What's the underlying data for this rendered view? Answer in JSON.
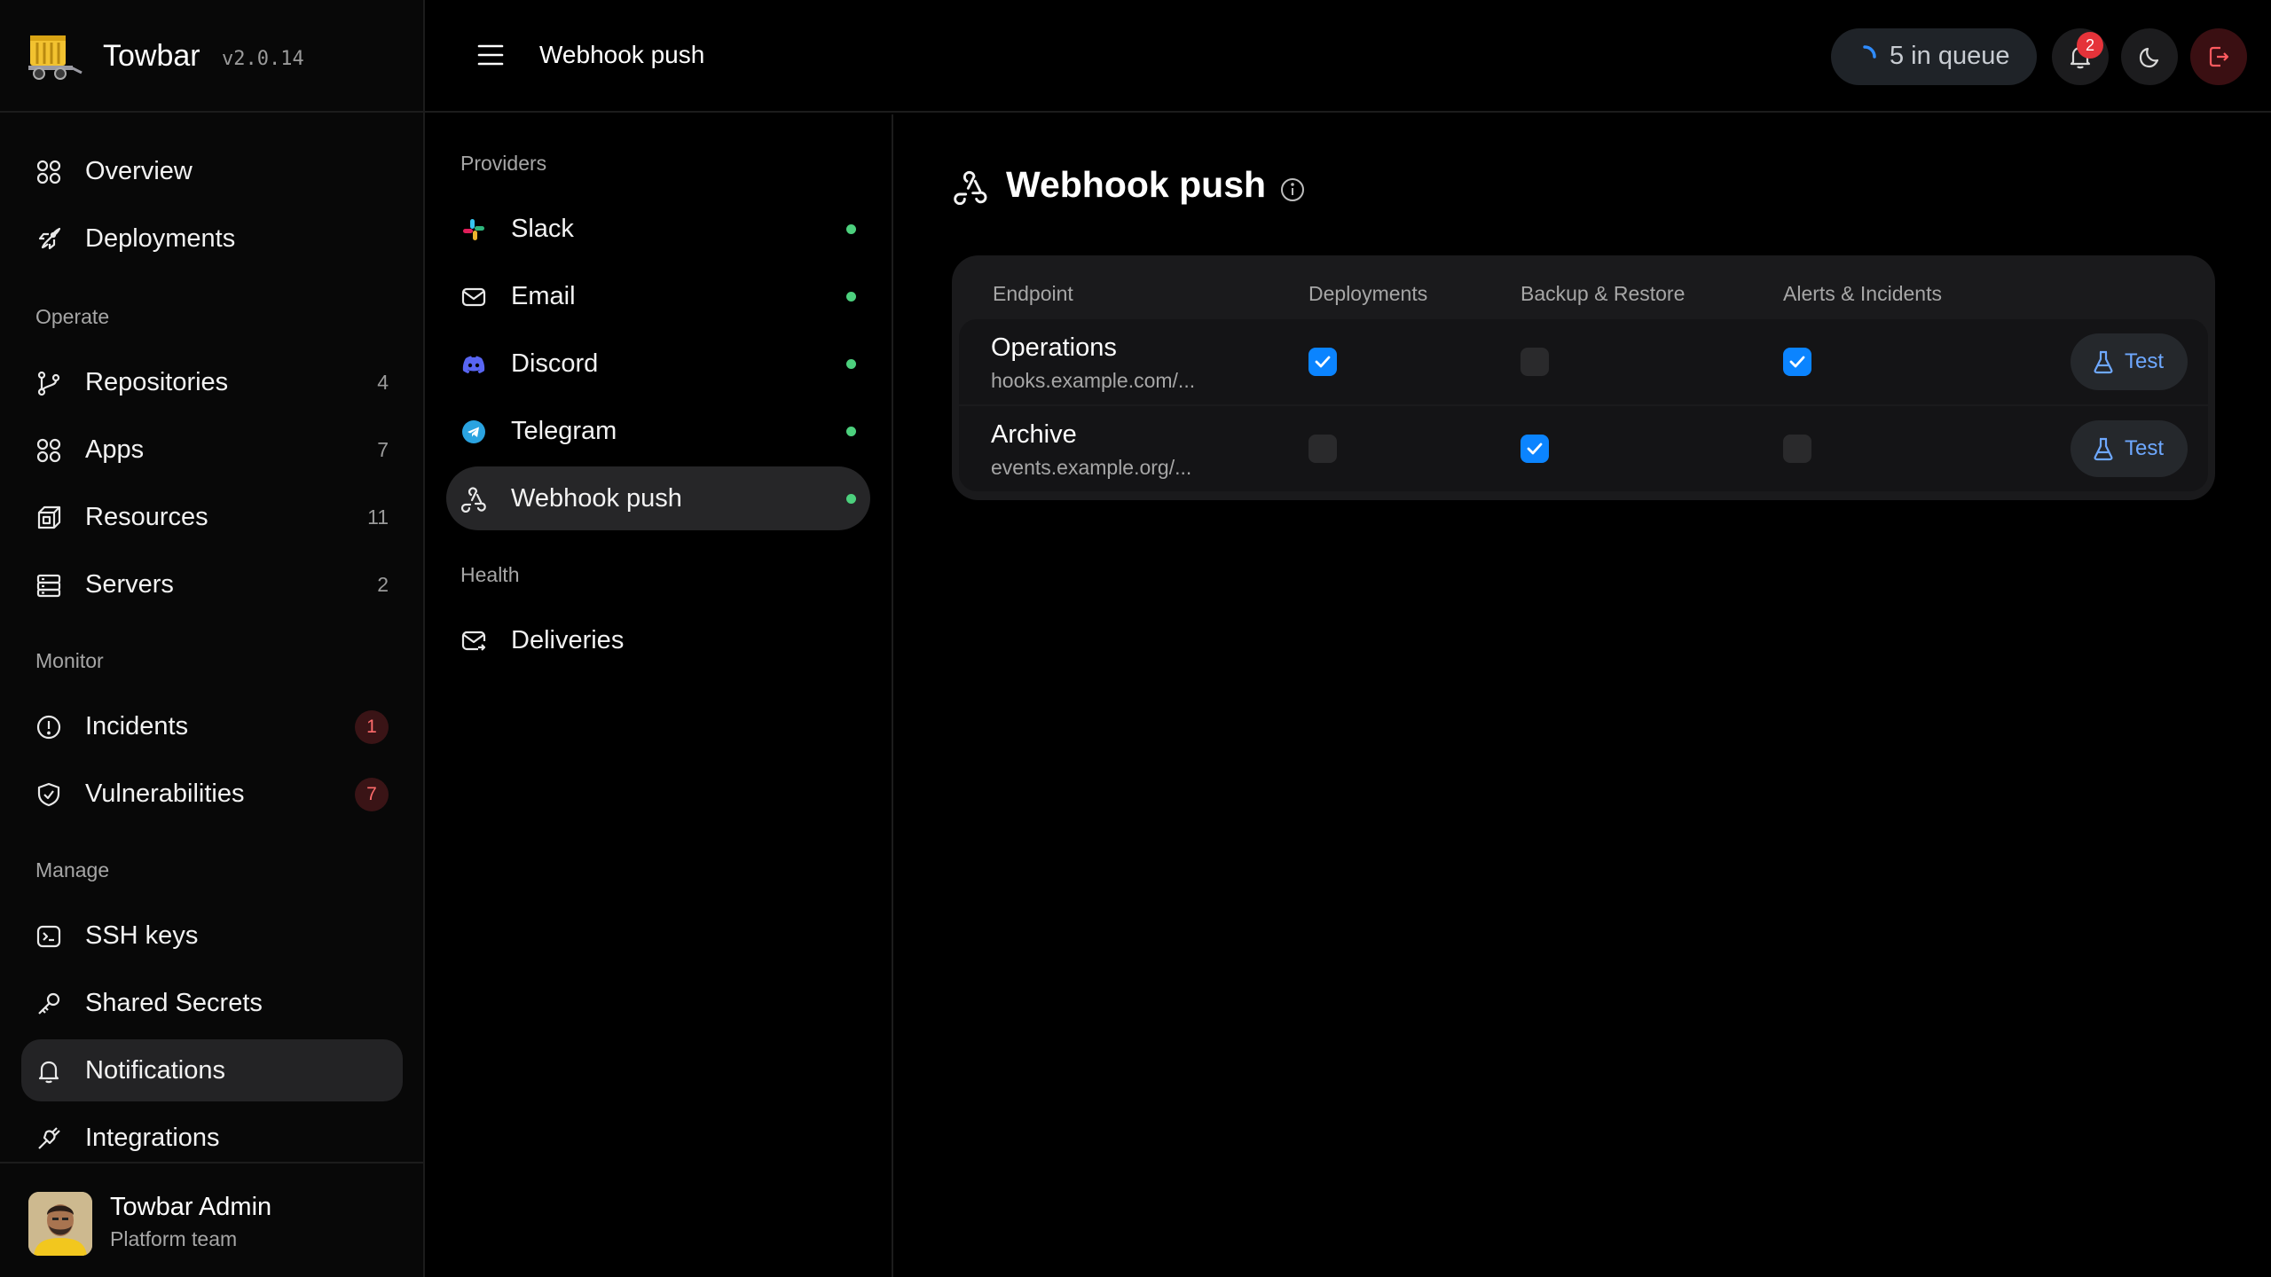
{
  "app": {
    "name": "Towbar",
    "version": "v2.0.14"
  },
  "sidebar": {
    "items_top": [
      {
        "label": "Overview",
        "icon": "grid-icon"
      },
      {
        "label": "Deployments",
        "icon": "rocket-icon"
      }
    ],
    "sections": [
      "Operate",
      "Monitor",
      "Manage"
    ],
    "operate": [
      {
        "label": "Repositories",
        "count": "4",
        "icon": "git-branch-icon"
      },
      {
        "label": "Apps",
        "count": "7",
        "icon": "apps-icon"
      },
      {
        "label": "Resources",
        "count": "11",
        "icon": "cube-icon"
      },
      {
        "label": "Servers",
        "count": "2",
        "icon": "server-icon"
      }
    ],
    "monitor": [
      {
        "label": "Incidents",
        "badge": "1",
        "icon": "alert-circle-icon"
      },
      {
        "label": "Vulnerabilities",
        "badge": "7",
        "icon": "shield-check-icon"
      }
    ],
    "manage": [
      {
        "label": "SSH keys",
        "icon": "terminal-icon"
      },
      {
        "label": "Shared Secrets",
        "icon": "key-icon"
      },
      {
        "label": "Notifications",
        "icon": "bell-icon",
        "active": true
      },
      {
        "label": "Integrations",
        "icon": "plug-icon"
      }
    ],
    "user": {
      "name": "Towbar Admin",
      "team": "Platform team"
    }
  },
  "topbar": {
    "title": "Webhook push",
    "queue_label": "5 in queue",
    "notification_count": "2"
  },
  "subnav": {
    "providers_label": "Providers",
    "providers": [
      {
        "label": "Slack",
        "icon": "slack-icon",
        "status": "connected"
      },
      {
        "label": "Email",
        "icon": "mail-icon",
        "status": "connected"
      },
      {
        "label": "Discord",
        "icon": "discord-icon",
        "status": "connected"
      },
      {
        "label": "Telegram",
        "icon": "telegram-icon",
        "status": "connected"
      },
      {
        "label": "Webhook push",
        "icon": "webhook-icon",
        "status": "connected",
        "active": true
      }
    ],
    "health_label": "Health",
    "health": [
      {
        "label": "Deliveries",
        "icon": "mail-out-icon"
      }
    ]
  },
  "main": {
    "title": "Webhook push",
    "table": {
      "headers": [
        "Endpoint",
        "Deployments",
        "Backup & Restore",
        "Alerts & Incidents"
      ],
      "rows": [
        {
          "name": "Operations",
          "url": "hooks.example.com/...",
          "deployments": true,
          "backup_restore": false,
          "alerts_incidents": true,
          "action": "Test"
        },
        {
          "name": "Archive",
          "url": "events.example.org/...",
          "deployments": false,
          "backup_restore": true,
          "alerts_incidents": false,
          "action": "Test"
        }
      ]
    }
  },
  "colors": {
    "accent": "#0b84ff",
    "status_ok": "#4cd07d",
    "danger": "#e5333a",
    "link": "#6ea8ff"
  }
}
